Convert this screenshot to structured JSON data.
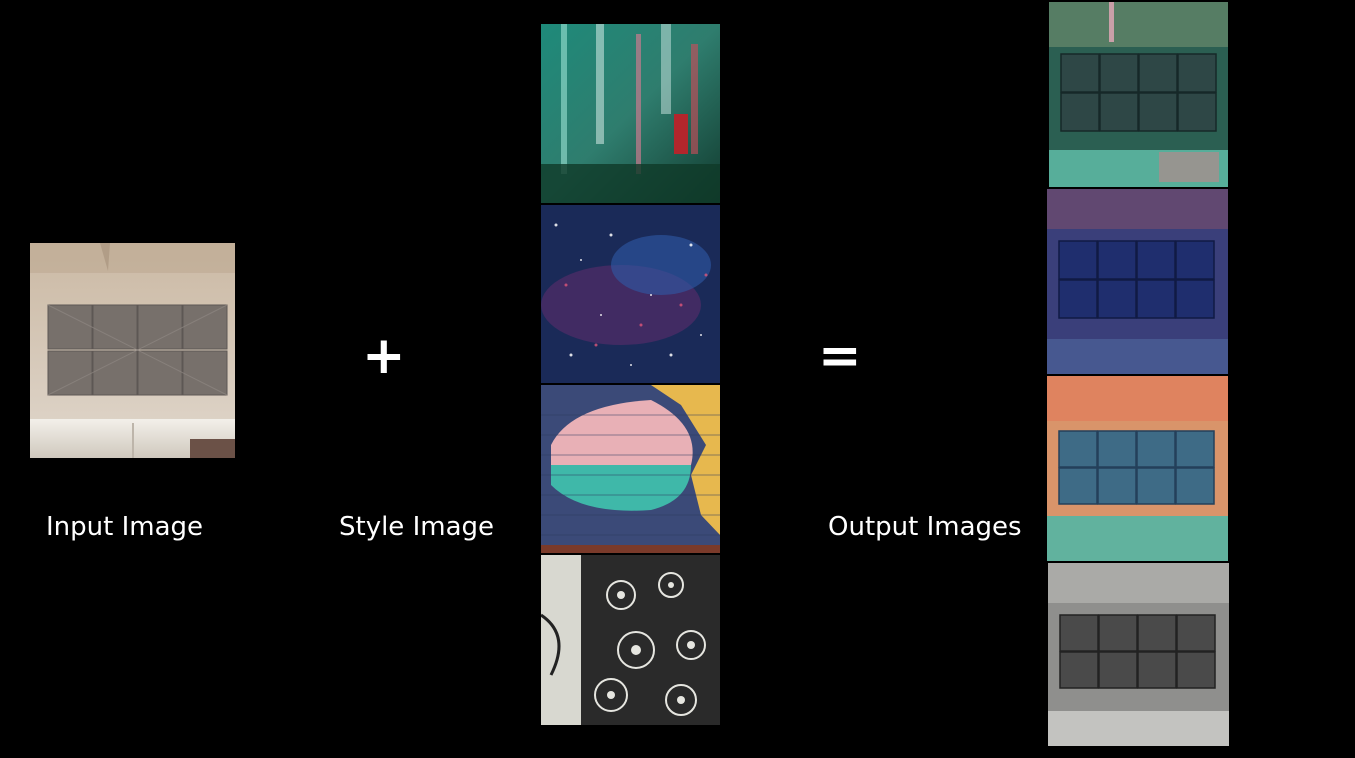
{
  "labels": {
    "input": "Input Image",
    "style": "Style Image",
    "output": "Output Images"
  },
  "operators": {
    "plus": "+",
    "equals": "="
  }
}
